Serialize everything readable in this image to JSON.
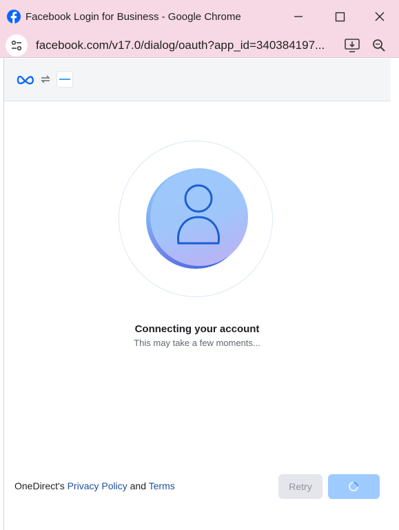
{
  "window": {
    "title": "Facebook Login for Business - Google Chrome",
    "url": "facebook.com/v17.0/dialog/oauth?app_id=340384197..."
  },
  "icons": {
    "browser_logo": "facebook-icon",
    "minimize": "minimize-icon",
    "maximize": "maximize-icon",
    "close": "close-icon",
    "site_info": "tune-icon",
    "install": "install-app-icon",
    "zoom": "zoom-icon",
    "meta": "meta-logo",
    "sync": "sync-icon",
    "partner": "onedirect-logo",
    "spinner": "loading-spinner-icon"
  },
  "main": {
    "heading": "Connecting your account",
    "subtext": "This may take a few moments..."
  },
  "footer": {
    "prefix": "OneDirect's",
    "privacy_link": "Privacy Policy",
    "conjunction": "and",
    "terms_link": "Terms"
  },
  "buttons": {
    "retry": "Retry"
  },
  "colors": {
    "chrome_frame": "#f6d9e4",
    "link": "#1e4e9c",
    "primary_button": "#9ecbff",
    "secondary_button": "#e4e6eb",
    "avatar_stroke": "#1c5fd0"
  }
}
